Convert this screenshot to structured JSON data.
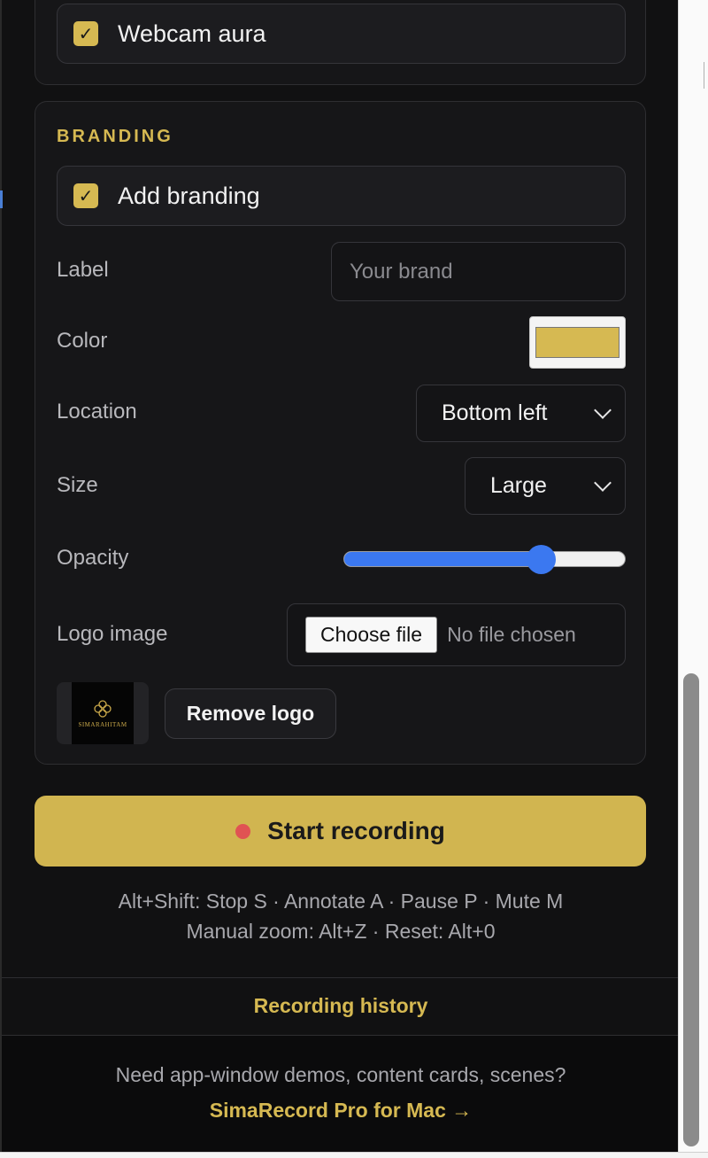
{
  "webcam": {
    "aura_label": "Webcam aura",
    "aura_checked": true
  },
  "branding": {
    "section_title": "BRANDING",
    "add_label": "Add branding",
    "add_checked": true,
    "label_field": {
      "label": "Label",
      "placeholder": "Your brand",
      "value": ""
    },
    "color_field": {
      "label": "Color",
      "value": "#d6b952"
    },
    "location_field": {
      "label": "Location",
      "value": "Bottom left"
    },
    "size_field": {
      "label": "Size",
      "value": "Large"
    },
    "opacity_field": {
      "label": "Opacity",
      "value": 0.7
    },
    "logo_field": {
      "label": "Logo image",
      "button": "Choose file",
      "status": "No file chosen"
    },
    "logo_preview_text": "SIMARAHITAM",
    "remove_logo": "Remove logo"
  },
  "start_button": {
    "label": "Start recording"
  },
  "hints": {
    "line1": "Alt+Shift: Stop S · Annotate A · Pause P · Mute M",
    "line2": "Manual zoom: Alt+Z · Reset: Alt+0"
  },
  "history_link": "Recording history",
  "promo": {
    "text": "Need app-window demos, content cards, scenes?",
    "link": "SimaRecord Pro for Mac →"
  },
  "colors": {
    "accent": "#d6b952",
    "record_dot": "#e05353",
    "slider": "#3b78f0",
    "background": "#111112"
  }
}
